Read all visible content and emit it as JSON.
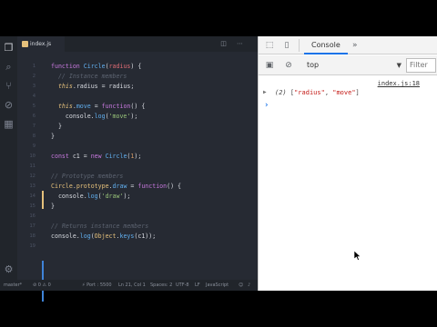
{
  "editor": {
    "tab_label": "index.js",
    "activity_icons": [
      "files-icon",
      "search-icon",
      "source-control-icon",
      "debug-icon",
      "extensions-icon",
      "settings-gear-icon"
    ],
    "lines": [
      {
        "n": "1",
        "text": "function Circle(radius) {"
      },
      {
        "n": "2",
        "text": "  // Instance members"
      },
      {
        "n": "3",
        "text": "  this.radius = radius;"
      },
      {
        "n": "4",
        "text": ""
      },
      {
        "n": "5",
        "text": "  this.move = function() {"
      },
      {
        "n": "6",
        "text": "    console.log('move');"
      },
      {
        "n": "7",
        "text": "  }"
      },
      {
        "n": "8",
        "text": "}"
      },
      {
        "n": "9",
        "text": ""
      },
      {
        "n": "10",
        "text": "const c1 = new Circle(1);"
      },
      {
        "n": "11",
        "text": ""
      },
      {
        "n": "12",
        "text": "// Prototype members"
      },
      {
        "n": "13",
        "text": "Circle.prototype.draw = function() {"
      },
      {
        "n": "14",
        "text": "  console.log('draw');"
      },
      {
        "n": "15",
        "text": "}"
      },
      {
        "n": "16",
        "text": ""
      },
      {
        "n": "17",
        "text": "// Returns instance members"
      },
      {
        "n": "18",
        "text": "console.log(Object.keys(c1));"
      },
      {
        "n": "19",
        "text": ""
      }
    ],
    "status": {
      "branch": "master*",
      "sync": "⊘ 0 ⚠ 0",
      "port": "⚡ Port : 5500",
      "position": "Ln 21, Col 1",
      "spaces": "Spaces: 2",
      "encoding": "UTF-8",
      "eol": "LF",
      "language": "JavaScript"
    }
  },
  "devtools": {
    "tab_console": "Console",
    "more": "»",
    "context": "top",
    "filter_placeholder": "Filter",
    "log_source": "index.js:18",
    "log_count": "(2)",
    "log_open": " [",
    "log_item1": "\"radius\"",
    "log_comma": ", ",
    "log_item2": "\"move\"",
    "log_close": "]",
    "prompt": "›"
  },
  "colors": {
    "editor_bg": "#262a33",
    "keyword": "#c678dd",
    "function": "#61afef",
    "comment": "#5c6370",
    "string": "#98c379",
    "accent": "#1a73e8"
  }
}
